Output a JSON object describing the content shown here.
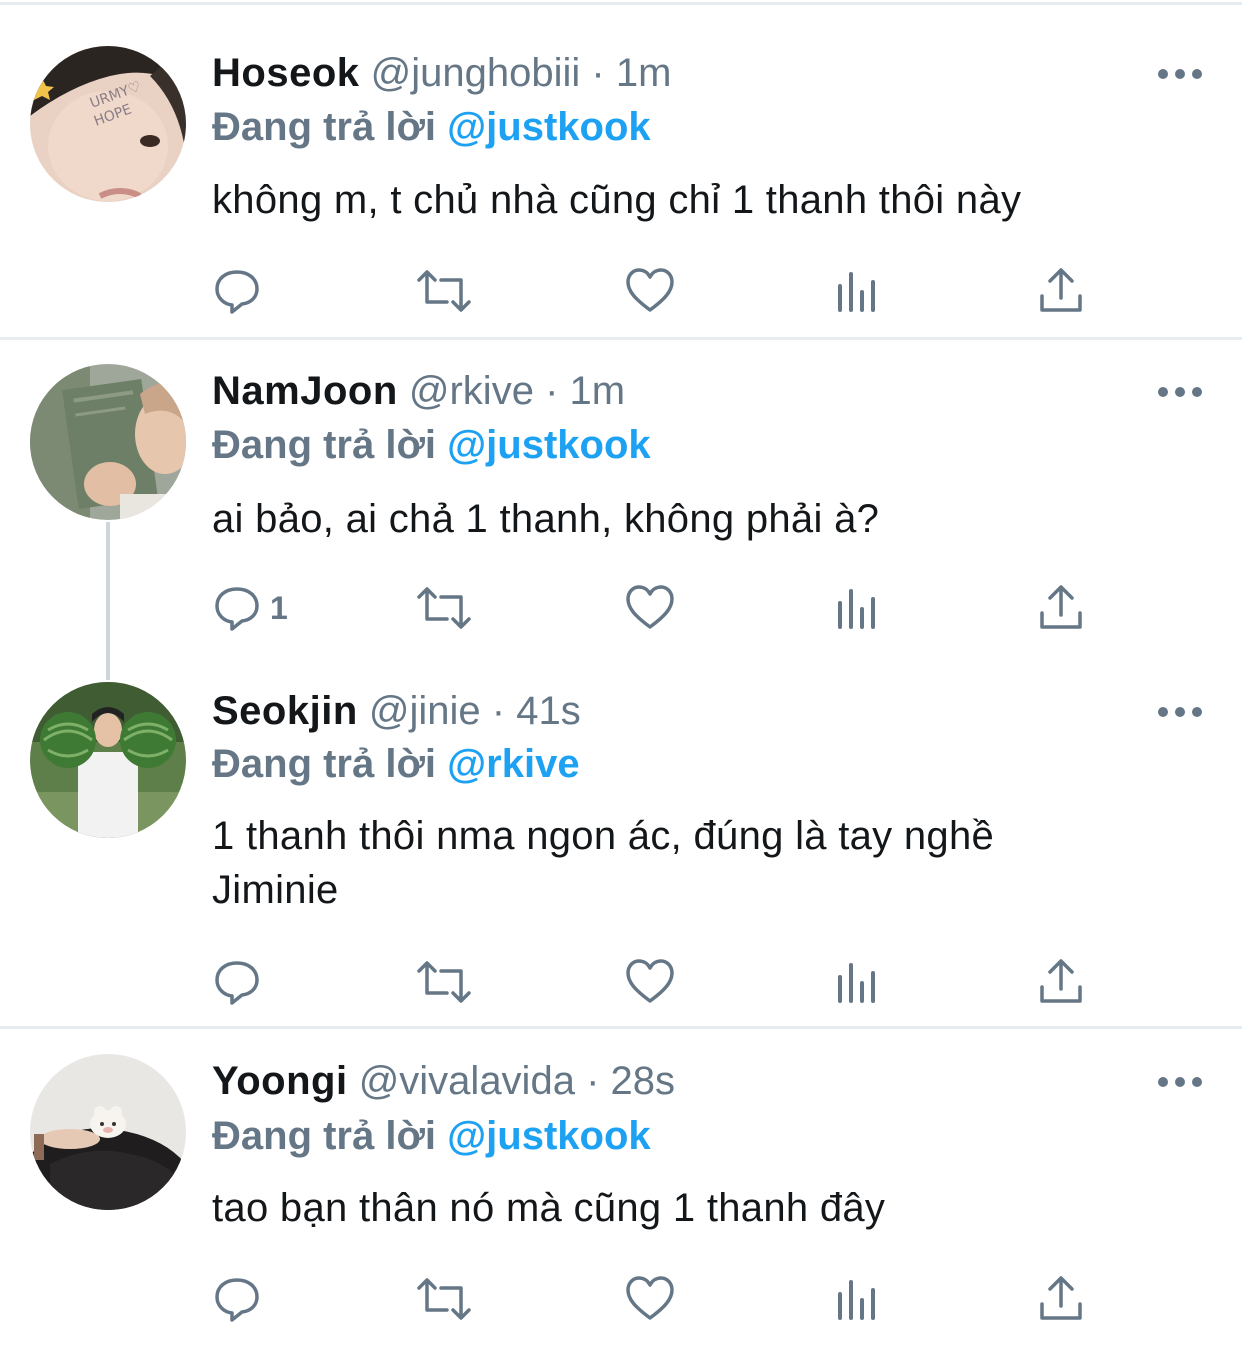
{
  "reply_prefix": "Đang trả lời",
  "colors": {
    "accent": "#1da1f2",
    "secondary_text": "#657786",
    "divider": "#e6ecf0"
  },
  "tweets": [
    {
      "name": "Hoseok",
      "handle": "@junghobiii",
      "separator": "·",
      "time": "1m",
      "reply_to": "@justkook",
      "lines": [
        "không m, t chủ nhà cũng chỉ 1 thanh thôi này"
      ],
      "avatar_text": [
        "URMY♡",
        "HOPE"
      ],
      "reply_count": ""
    },
    {
      "name": "NamJoon",
      "handle": "@rkive",
      "separator": "·",
      "time": "1m",
      "reply_to": "@justkook",
      "lines": [
        "ai bảo, ai chả 1 thanh, không phải à?"
      ],
      "reply_count": "1"
    },
    {
      "name": "Seokjin",
      "handle": "@jinie",
      "separator": "·",
      "time": "41s",
      "reply_to": "@rkive",
      "lines": [
        "1 thanh thôi nma ngon ác, đúng là tay nghề",
        "Jiminie"
      ],
      "reply_count": ""
    },
    {
      "name": "Yoongi",
      "handle": "@vivalavida",
      "separator": "·",
      "time": "28s",
      "reply_to": "@justkook",
      "lines": [
        "tao bạn thân nó mà cũng 1 thanh đây"
      ],
      "reply_count": ""
    }
  ],
  "icons": [
    "reply-icon",
    "retweet-icon",
    "like-icon",
    "analytics-icon",
    "share-icon",
    "more-icon"
  ]
}
